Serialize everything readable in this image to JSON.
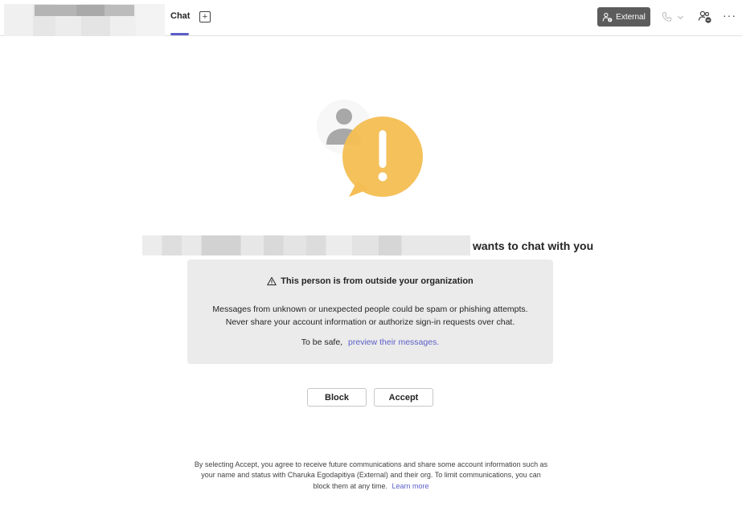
{
  "header": {
    "tab_label": "Chat",
    "add_tab_symbol": "+",
    "external_label": "External",
    "more_symbol": "···",
    "icons": {
      "add_tab": "add-tab-icon",
      "external": "external-user-icon",
      "call": "phone-icon",
      "call_dropdown": "chevron-down-icon",
      "people": "people-settings-icon",
      "more": "more-options-icon"
    }
  },
  "illustration": {
    "icon": "external-person-warning-illustration",
    "colors": {
      "bubble": "#F4BE54",
      "mark": "#ffffff",
      "person": "#9e9e9e"
    }
  },
  "request": {
    "text": "wants to chat with you"
  },
  "warning": {
    "icon": "warning-triangle-icon",
    "title": "This person is from outside your organization",
    "body_line1": "Messages from unknown or unexpected people could be spam or phishing attempts.",
    "body_line2": "Never share your account information or authorize sign-in requests over chat.",
    "safe_prefix": "To be safe,",
    "safe_link": "preview their messages."
  },
  "actions": {
    "block_label": "Block",
    "accept_label": "Accept"
  },
  "footer": {
    "line1": "By selecting Accept, you agree to receive future communications and share some account information such as",
    "line2": "your name and status with Charuka Egodapitiya (External) and their org. To limit communications, you can",
    "line3": "block them at any time.",
    "learn_more": "Learn more"
  },
  "colors": {
    "accent": "#5b5fc7",
    "external_badge_bg": "#5c5c5c",
    "warning_box_bg": "#ebebeb"
  }
}
